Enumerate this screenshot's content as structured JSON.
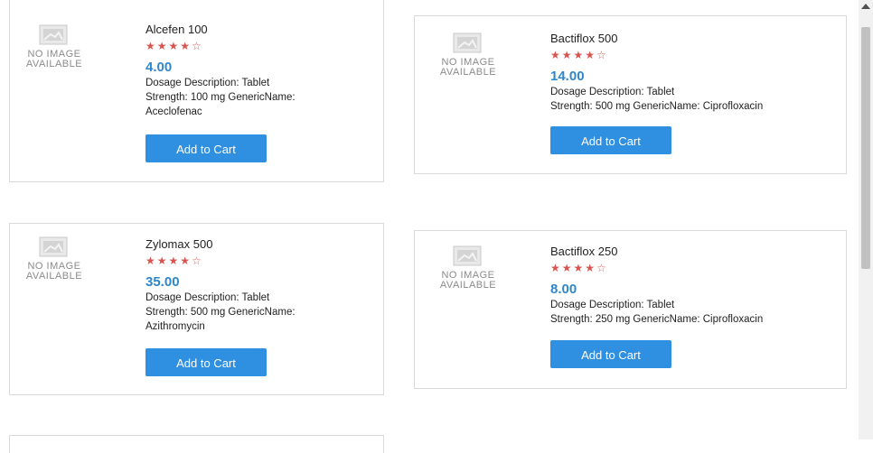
{
  "no_image_text": [
    "NO IMAGE",
    "AVAILABLE"
  ],
  "cart_button_label": "Add to Cart",
  "colors": {
    "stars": "#d9534f",
    "price": "#2f86c9",
    "button": "#2f8fe0"
  },
  "products": [
    {
      "name": "Alcefen 100",
      "rating": 4,
      "rating_max": 5,
      "price": "4.00",
      "dosage": "Dosage Description: Tablet",
      "strength_line1": "Strength: 100 mg GenericName:",
      "strength_line2": "Aceclofenac"
    },
    {
      "name": "Bactiflox 500",
      "rating": 4,
      "rating_max": 5,
      "price": "14.00",
      "dosage": "Dosage Description: Tablet",
      "strength_line1": "Strength: 500 mg GenericName: Ciprofloxacin",
      "strength_line2": ""
    },
    {
      "name": "Zylomax 500",
      "rating": 4,
      "rating_max": 5,
      "price": "35.00",
      "dosage": "Dosage Description: Tablet",
      "strength_line1": "Strength: 500 mg GenericName:",
      "strength_line2": "Azithromycin"
    },
    {
      "name": "Bactiflox 250",
      "rating": 4,
      "rating_max": 5,
      "price": "8.00",
      "dosage": "Dosage Description: Tablet",
      "strength_line1": "Strength: 250 mg GenericName: Ciprofloxacin",
      "strength_line2": ""
    }
  ]
}
